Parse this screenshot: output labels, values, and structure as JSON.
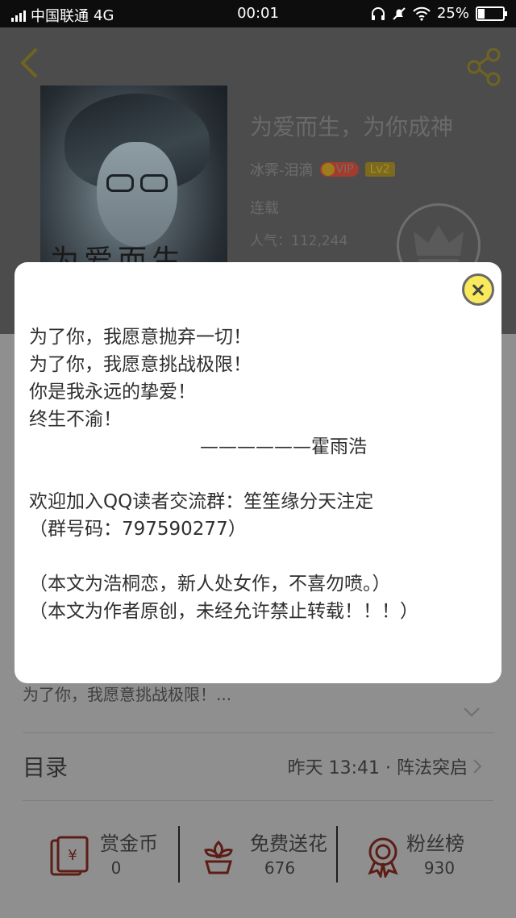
{
  "status_bar": {
    "carrier": "中国联通",
    "network": "4G",
    "time": "00:01",
    "battery_label": "25%",
    "battery_level": 0.25,
    "icons": [
      "signal-icon",
      "headphones-icon",
      "mute-icon",
      "wifi-icon",
      "battery-icon"
    ]
  },
  "book": {
    "cover_title": "为爱而生",
    "title": "为爱而生，为你成神",
    "author": "冰霁-泪滴",
    "vip_badge": "VIP",
    "level_badge": "Lv2",
    "status": "连载",
    "popularity": "人气：112,244"
  },
  "description_preview": "为了你，我愿意挑战极限！...",
  "toc": {
    "label": "目录",
    "latest": "昨天 13:41 · 阵法突启"
  },
  "actions": [
    {
      "label": "赏金币",
      "count": "0",
      "icon": "coin-envelope-icon"
    },
    {
      "label": "免费送花",
      "count": "676",
      "icon": "flower-icon"
    },
    {
      "label": "粉丝榜",
      "count": "930",
      "icon": "medal-icon"
    }
  ],
  "modal": {
    "lines": [
      "为了你，我愿意抛弃一切！",
      "为了你，我愿意挑战极限！",
      "你是我永远的挚爱！",
      "终生不渝！",
      "——————霍雨浩",
      "",
      "欢迎加入QQ读者交流群：笙笙缘分天注定",
      "（群号码：797590277）",
      "",
      "（本文为浩桐恋，新人处女作，不喜勿喷。）",
      "（本文为作者原创，未经允许禁止转载！！！）"
    ]
  },
  "colors": {
    "overlay_gray": "#8f8f8f",
    "close_button": "#f9ea5c",
    "vip_red": "#a33c2e"
  }
}
